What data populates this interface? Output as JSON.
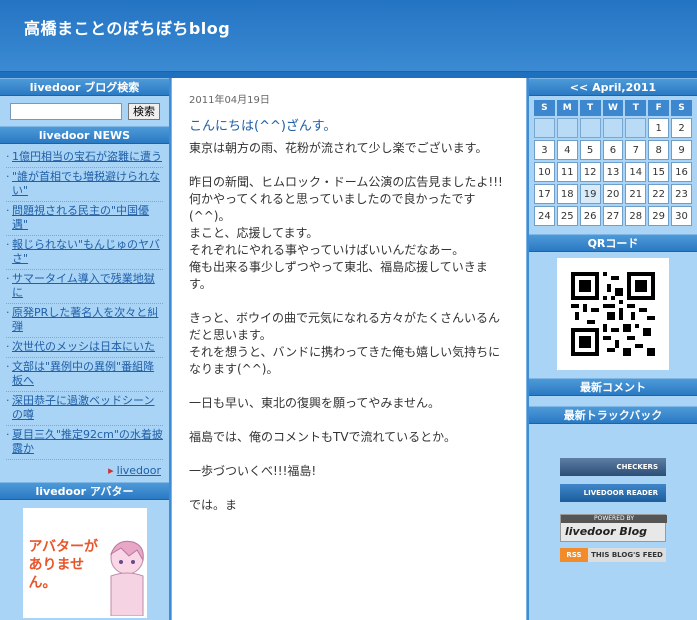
{
  "site": {
    "title": "高橋まことのぼちぼちblog"
  },
  "search": {
    "title": "livedoor ブログ検索",
    "button": "検索",
    "value": ""
  },
  "news": {
    "title": "livedoor NEWS",
    "items": [
      "1億円相当の宝石が盗難に遭う",
      "\"誰が首相でも増税避けられない\"",
      "問題視される民主の\"中国優遇\"",
      "報じられない\"もんじゅのヤバさ\"",
      "サマータイム導入で残業地獄に",
      "原発PRした著名人を次々と糾弾",
      "次世代のメッシは日本にいた",
      "文部は\"異例中の異例\"番組降板へ",
      "深田恭子に過激ベッドシーンの噂",
      "夏目三久\"推定92cm\"の水着披露か"
    ],
    "footer": "livedoor"
  },
  "avatar": {
    "title": "livedoor アバター",
    "message": "アバターがありません。"
  },
  "post": {
    "date": "2011年04月19日",
    "title": "こんにちは(^^)ざんす。",
    "paragraphs": [
      "東京は朝方の雨、花粉が流されて少し楽でございます。",
      "昨日の新聞、ヒムロック・ドーム公演の広告見ましたよ!!!\n何かやってくれると思っていましたので良かったです(^^)。\nまこと、応援してます。\nそれぞれにやれる事やっていけばいいんだなあー。\n俺も出来る事少しずつやって東北、福島応援していきます。",
      "きっと、ボウイの曲で元気になれる方々がたくさんいるんだと思います。\nそれを想うと、バンドに携わってきた俺も嬉しい気持ちになります(^^)。",
      "一日も早い、東北の復興を願ってやみません。",
      "福島では、俺のコメントもTVで流れているとか。",
      "一歩づついくべ!!!福島!",
      "では。ま"
    ]
  },
  "calendar": {
    "prev": "<<",
    "month_label": "April,2011",
    "weekdays": [
      "S",
      "M",
      "T",
      "W",
      "T",
      "F",
      "S"
    ],
    "weeks": [
      [
        "",
        "",
        "",
        "",
        "",
        "1",
        "2"
      ],
      [
        "3",
        "4",
        "5",
        "6",
        "7",
        "8",
        "9"
      ],
      [
        "10",
        "11",
        "12",
        "13",
        "14",
        "15",
        "16"
      ],
      [
        "17",
        "18",
        "19",
        "20",
        "21",
        "22",
        "23"
      ],
      [
        "24",
        "25",
        "26",
        "27",
        "28",
        "29",
        "30"
      ]
    ],
    "linked_days": [
      "19"
    ]
  },
  "qr": {
    "title": "QRコード"
  },
  "comments": {
    "title": "最新コメント"
  },
  "trackback": {
    "title": "最新トラックバック"
  },
  "badges": {
    "checkers": "CHECKERS",
    "reader": "LIVEDOOR READER",
    "powered": "POWERED BY",
    "powered_brand": "livedoor Blog",
    "rss": "RSS",
    "feed": "THIS BLOG'S FEED"
  },
  "colors": {
    "accent": "#2474c4",
    "link": "#2160a8",
    "sidebar": "#a9d4f5"
  }
}
